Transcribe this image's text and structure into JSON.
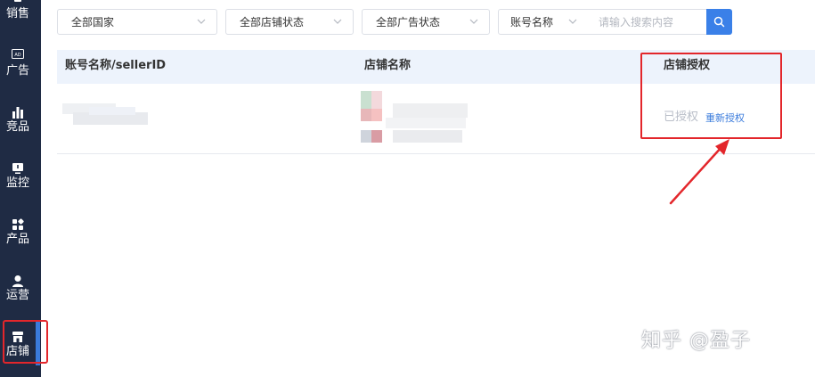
{
  "sidebar": {
    "items": [
      {
        "label": "销售",
        "icon": "sales-icon"
      },
      {
        "label": "广告",
        "icon": "ad-icon",
        "badge": "AD"
      },
      {
        "label": "竞品",
        "icon": "bar-chart-icon"
      },
      {
        "label": "监控",
        "icon": "monitor-icon"
      },
      {
        "label": "产品",
        "icon": "grid-icon"
      },
      {
        "label": "运营",
        "icon": "user-icon"
      },
      {
        "label": "店铺",
        "icon": "store-icon",
        "active": true
      }
    ]
  },
  "filters": {
    "country": "全部国家",
    "shop_status": "全部店铺状态",
    "ad_status": "全部广告状态",
    "account_field": "账号名称",
    "search_placeholder": "请输入搜索内容"
  },
  "table": {
    "columns": [
      "账号名称/sellerID",
      "店铺名称",
      "店铺授权"
    ],
    "rows": [
      {
        "auth_status": "已授权",
        "reauth_link": "重新授权"
      }
    ]
  },
  "watermark": "知乎 @盈子",
  "colors": {
    "sidebar_bg": "#1f2b44",
    "accent": "#3a80e8",
    "header_bg": "#edf3fc",
    "annotation_red": "#e3262b"
  }
}
